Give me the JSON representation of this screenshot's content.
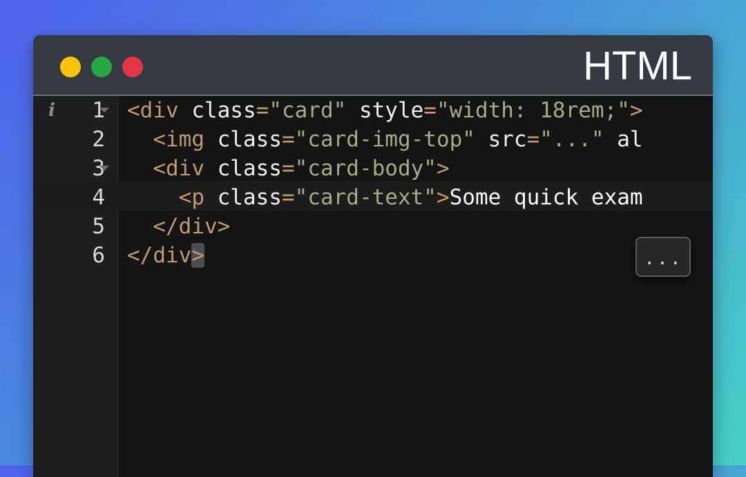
{
  "window": {
    "title": "HTML",
    "traffic_lights": [
      "yellow",
      "green",
      "red"
    ],
    "colors": {
      "yellow": "#fdc30a",
      "green": "#26a944",
      "red": "#e13546",
      "titlebar": "#353a42",
      "editor_bg": "#141414",
      "tag": "#c19a6b",
      "string": "#a3ac82"
    }
  },
  "editor": {
    "gutter_icon": "info-icon",
    "more_button_label": "...",
    "lines": [
      {
        "number": "1",
        "foldable": true,
        "tokens": [
          {
            "t": "tg",
            "v": "<div"
          },
          {
            "t": "at",
            "v": " class"
          },
          {
            "t": "eq",
            "v": "="
          },
          {
            "t": "sv",
            "v": "\"card\""
          },
          {
            "t": "at",
            "v": " style"
          },
          {
            "t": "eq",
            "v": "="
          },
          {
            "t": "sv",
            "v": "\"width: 18rem;\""
          },
          {
            "t": "tg",
            "v": ">"
          }
        ]
      },
      {
        "number": "2",
        "foldable": false,
        "tokens": [
          {
            "t": "tx",
            "v": "  "
          },
          {
            "t": "tg",
            "v": "<img"
          },
          {
            "t": "at",
            "v": " class"
          },
          {
            "t": "eq",
            "v": "="
          },
          {
            "t": "sv",
            "v": "\"card-img-top\""
          },
          {
            "t": "at",
            "v": " src"
          },
          {
            "t": "eq",
            "v": "="
          },
          {
            "t": "sv",
            "v": "\"...\""
          },
          {
            "t": "at",
            "v": " al"
          }
        ]
      },
      {
        "number": "3",
        "foldable": true,
        "tokens": [
          {
            "t": "tx",
            "v": "  "
          },
          {
            "t": "tg",
            "v": "<div"
          },
          {
            "t": "at",
            "v": " class"
          },
          {
            "t": "eq",
            "v": "="
          },
          {
            "t": "sv",
            "v": "\"card-body\""
          },
          {
            "t": "tg",
            "v": ">"
          }
        ]
      },
      {
        "number": "4",
        "foldable": false,
        "tokens": [
          {
            "t": "tx",
            "v": "    "
          },
          {
            "t": "tg",
            "v": "<p"
          },
          {
            "t": "at",
            "v": " class"
          },
          {
            "t": "eq",
            "v": "="
          },
          {
            "t": "sv",
            "v": "\"card-text\""
          },
          {
            "t": "tg",
            "v": ">"
          },
          {
            "t": "tx",
            "v": "Some quick exam"
          }
        ]
      },
      {
        "number": "5",
        "foldable": false,
        "tokens": [
          {
            "t": "tx",
            "v": "  "
          },
          {
            "t": "tg",
            "v": "</div>"
          }
        ]
      },
      {
        "number": "6",
        "foldable": false,
        "active": true,
        "tokens": [
          {
            "t": "tg",
            "v": "</div"
          },
          {
            "t": "match",
            "v": ">"
          }
        ]
      }
    ]
  }
}
